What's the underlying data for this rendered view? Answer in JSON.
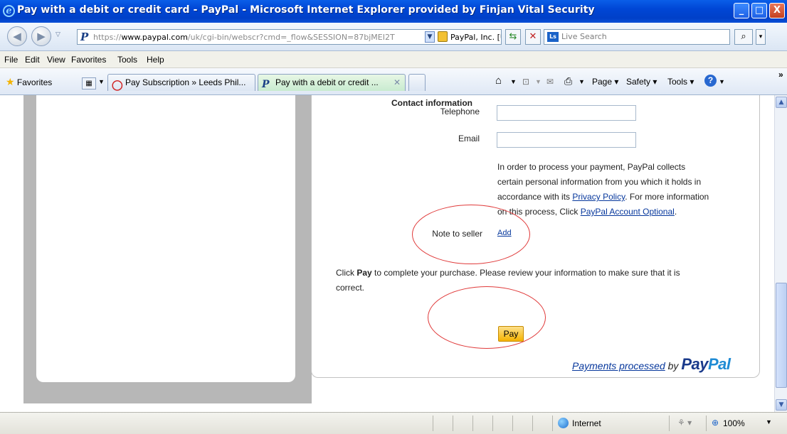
{
  "window": {
    "title": "Pay with a debit or credit card - PayPal - Microsoft Internet Explorer provided by Finjan Vital Security",
    "minimize": "_",
    "maximize": "□",
    "close": "X"
  },
  "address": {
    "url_prefix": "https://",
    "url_domain": "www.paypal.com",
    "url_path": "/uk/cgi-bin/webscr?cmd=_flow&SESSION=87bjMEI2T",
    "site_identity": "PayPal, Inc. [US]",
    "search_placeholder": "Live Search"
  },
  "menu": {
    "file": "File",
    "edit": "Edit",
    "view": "View",
    "favorites": "Favorites",
    "tools": "Tools",
    "help": "Help"
  },
  "toolbar": {
    "favorites": "Favorites",
    "tabs": [
      {
        "label": "Pay Subscription » Leeds Phil..."
      },
      {
        "label": "Pay with a debit or credit ..."
      }
    ],
    "page": "Page",
    "safety": "Safety",
    "tools": "Tools"
  },
  "form": {
    "contact_heading": "Contact information",
    "telephone_label": "Telephone",
    "telephone_value": "",
    "email_label": "Email",
    "email_value": "",
    "privacy_text_1": "In order to process your payment, PayPal collects",
    "privacy_text_2": "certain personal information from you which it holds in",
    "privacy_text_3a": "accordance with its ",
    "privacy_link": "Privacy Policy",
    "privacy_text_3b": ". For more information",
    "privacy_text_4a": "on this process, Click ",
    "account_link": "PayPal Account Optional",
    "privacy_text_4b": ".",
    "note_label": "Note to seller",
    "note_add": "Add",
    "instruction_a": "Click ",
    "instruction_bold": "Pay",
    "instruction_b": " to complete your purchase. Please review your information to make sure that it is",
    "instruction_c": "correct.",
    "pay_button": "Pay",
    "footer_processed": "Payments processed",
    "footer_by": " by ",
    "logo_pay": "Pay",
    "logo_pal": "Pal"
  },
  "status": {
    "zone": "Internet",
    "zoom": "100%"
  }
}
